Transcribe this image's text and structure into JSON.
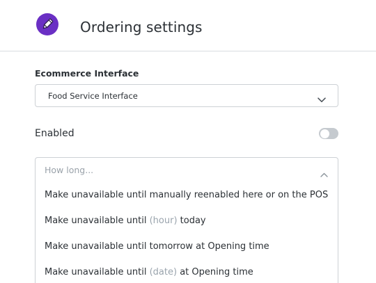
{
  "header": {
    "title": "Ordering settings",
    "icon": "pencil-icon",
    "icon_color": "#6a2fc4"
  },
  "ecommerce": {
    "label": "Ecommerce Interface",
    "selected": "Food Service Interface",
    "chevron_icon": "chevron-down-icon"
  },
  "enabled": {
    "label": "Enabled",
    "value": false
  },
  "how_long": {
    "placeholder": "How long...",
    "chevron_icon": "chevron-up-icon",
    "options": [
      {
        "before": "Make unavailable until manually reenabled here or on the POS",
        "placeholder": "",
        "after": ""
      },
      {
        "before": "Make unavailable until ",
        "placeholder": "(hour)",
        "after": " today"
      },
      {
        "before": "Make unavailable until tomorrow at Opening time",
        "placeholder": "",
        "after": ""
      },
      {
        "before": "Make unavailable until ",
        "placeholder": "(date)",
        "after": " at Opening time"
      }
    ]
  }
}
